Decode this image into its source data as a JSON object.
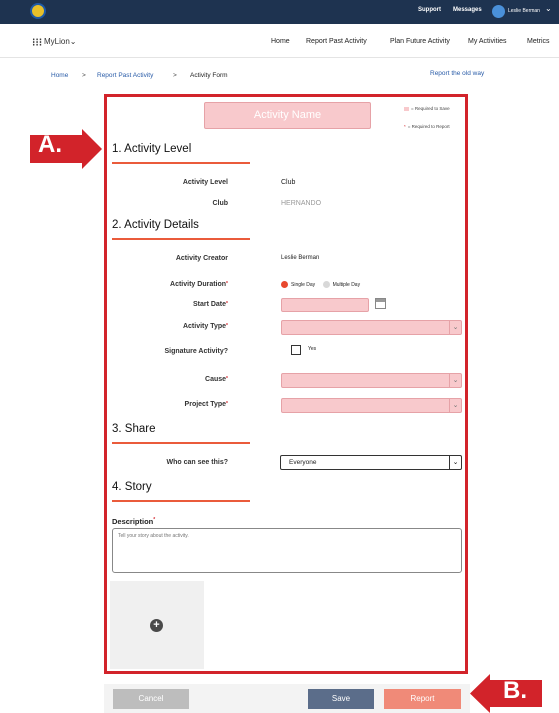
{
  "topbar": {
    "links": [
      "Support",
      "Messages"
    ],
    "user_name": "Leslie Berman"
  },
  "nav": {
    "app_name": "MyLion",
    "app_caret": "⌄",
    "items": [
      "Home",
      "Report Past Activity",
      "Plan Future Activity",
      "My Activities",
      "Metrics"
    ]
  },
  "breadcrumb": {
    "home": "Home",
    "sep": ">",
    "report_past": "Report Past Activity",
    "current": "Activity Form",
    "old_way": "Report the old way"
  },
  "form": {
    "activity_name_placeholder": "Activity Name",
    "legend": {
      "required_save": "= Required to Save",
      "required_report": "= Required to Report"
    },
    "sections": {
      "level": "1. Activity Level",
      "details": "2. Activity Details",
      "share": "3. Share",
      "story": "4. Story"
    },
    "fields": {
      "activity_level_label": "Activity Level",
      "activity_level_value": "Club",
      "club_label": "Club",
      "club_value": "HERNANDO",
      "creator_label": "Activity Creator",
      "creator_value": "Leslie Berman",
      "duration_label": "Activity Duration",
      "duration_single": "Single Day",
      "duration_multiple": "Multiple Day",
      "start_date_label": "Start Date",
      "type_label": "Activity Type",
      "signature_label": "Signature Activity?",
      "signature_option": "Yes",
      "cause_label": "Cause",
      "project_type_label": "Project Type",
      "share_label": "Who can see this?",
      "share_value": "Everyone",
      "description_label": "Description",
      "description_placeholder": "Tell your story about the activity."
    },
    "required_mark": "*",
    "upload_plus": "+"
  },
  "footer": {
    "cancel": "Cancel",
    "save": "Save",
    "report": "Report"
  },
  "callouts": {
    "a": "A.",
    "b": "B."
  },
  "colors": {
    "accent_red": "#d2232a",
    "section_line": "#ea5b3b",
    "required_pink": "#f8c9cc",
    "topbar": "#1e3350",
    "save_button": "#5b6d8a",
    "report_button": "#f08a78",
    "cancel_button": "#bdbdbd"
  }
}
